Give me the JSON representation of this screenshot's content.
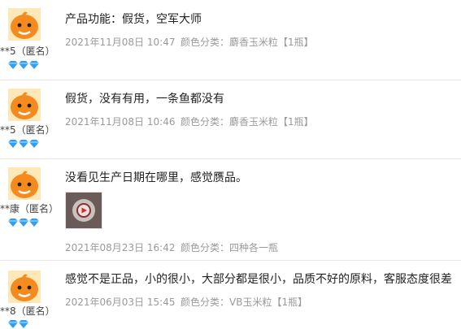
{
  "reviews": [
    {
      "user": "**5（匿名）",
      "content": "产品功能：假货，空军大师",
      "date": "2021年11月08日 10:47",
      "sku": "颜色分类：麝香玉米粒【1瓶】",
      "level_icon": "diamond-icon",
      "level_count": 3
    },
    {
      "user": "**5（匿名）",
      "content": "假货，没有有用，一条鱼都没有",
      "date": "2021年11月08日 10:46",
      "sku": "颜色分类：麝香玉米粒【1瓶】",
      "level_icon": "diamond-icon",
      "level_count": 3
    },
    {
      "user": "**康（匿名）",
      "content": "没看见生产日期在哪里，感觉赝品。",
      "date": "2021年08月23日 16:42",
      "sku": "颜色分类：四种各一瓶",
      "level_icon": "diamond-icon",
      "level_count": 3,
      "has_photo": true
    },
    {
      "user": "**8（匿名）",
      "content": "感觉不是正品，小的很小，大部分都是很小，品质不好的原料，客服态度很差",
      "date": "2021年06月03日 15:45",
      "sku": "颜色分类：VB玉米粒【1瓶】",
      "level_icon": "diamond-icon",
      "level_count": 2
    }
  ],
  "colors": {
    "avatar_orange": "#f58a1f",
    "diamond_blue": "#2f9ef5",
    "meta_gray": "#9a9a9a"
  }
}
